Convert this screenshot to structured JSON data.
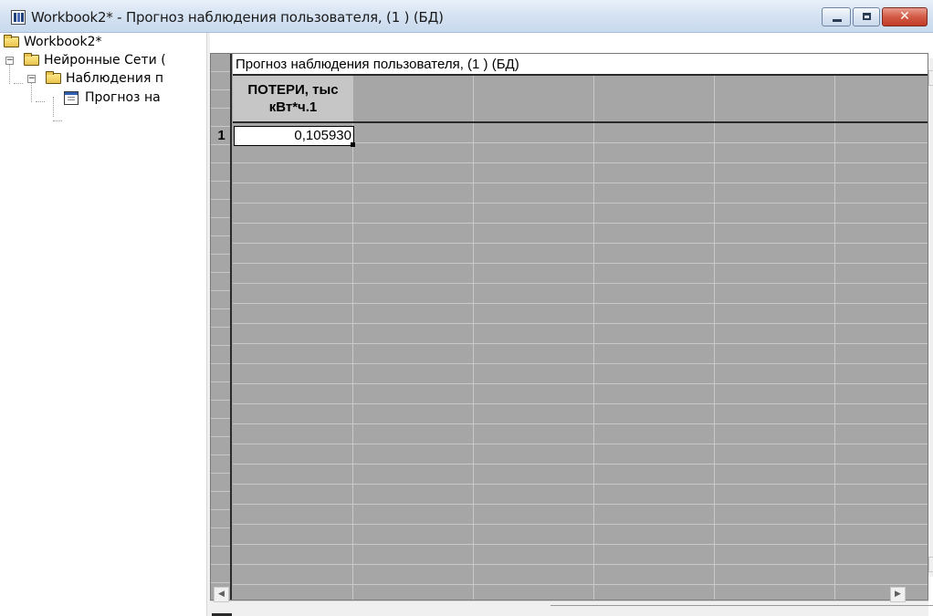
{
  "window": {
    "title": "Workbook2* - Прогноз наблюдения пользователя, (1 ) (БД)",
    "icon": "spreadsheet-app-icon",
    "controls": {
      "minimize": "minimize-icon",
      "maximize": "maximize-icon",
      "close": "close-icon",
      "close_glyph": "✕"
    }
  },
  "tree": {
    "items": [
      {
        "label": "Workbook2*",
        "icon": "folder-open-icon",
        "level": 0
      },
      {
        "label": "Нейронные Сети (",
        "icon": "folder-open-icon",
        "level": 1,
        "expander": "−"
      },
      {
        "label": "Наблюдения п",
        "icon": "folder-open-icon",
        "level": 2,
        "expander": "−"
      },
      {
        "label": "Прогноз на",
        "icon": "sheet-icon",
        "level": 3
      }
    ]
  },
  "grid": {
    "title": "Прогноз наблюдения пользователя, (1 ) (БД)",
    "columns": [
      "ПОТЕРИ, тыс кВт*ч.1"
    ],
    "column_line1": "ПОТЕРИ, тыс",
    "column_line2": "кВт*ч.1",
    "rows": [
      {
        "num": "1",
        "values": [
          "0,105930"
        ]
      }
    ]
  },
  "scrollbars": {
    "up_arrow": "▲",
    "down_arrow": "▼",
    "left_arrow": "◀",
    "right_arrow": "▶"
  },
  "colors": {
    "grid_background": "#a6a6a6",
    "header_cell": "#c6c6c6",
    "titlebar": "#d3e1f1",
    "close_button": "#c13b27"
  }
}
